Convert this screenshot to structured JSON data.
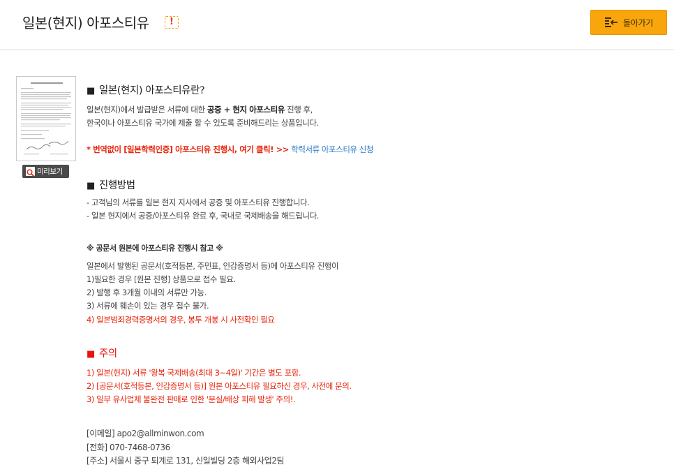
{
  "header": {
    "title": "일본(현지) 아포스티유",
    "alert_glyph": "!",
    "back_label": "돌아가기"
  },
  "sidebar": {
    "preview_label": "미리보기"
  },
  "intro": {
    "heading": "일본(현지) 아포스티유란?",
    "line1_a": "일본(현지)에서 발급받은 서류에 대한 ",
    "line1_b": "공증 + 현지 아포스티유",
    "line1_c": " 진행 후,",
    "line2": "한국이나 아포스티유 국가에 제출 할 수 있도록 준비해드리는 상품입니다.",
    "notice_text": "* 번역없이 [일본학력인증] 아포스티유 진행시, 여기 클릭! >>",
    "notice_link": " 학력서류 아포스티유 신청"
  },
  "process": {
    "heading": "진행방법",
    "lines": [
      "- 고객님의 서류를 일본 현지 지사에서 공증 및 아포스티유 진행합니다.",
      "- 일본 현지에서 공증/아포스티유 완료 후, 국내로 국제배송을 해드립니다."
    ],
    "note_title": "※ 공문서 원본에 아포스티유 진행시 참고 ※",
    "note_lines": [
      "일본에서 발행된 공문서(호적등본, 주민표, 인감증명서 등)에 아포스티유 진행이",
      "1)필요한 경우 [원본 진행] 상품으로 접수 필요.",
      "2) 발행 후 3개월 이내의 서류만 가능.",
      "3) 서류에 훼손이 있는 경우 접수 불가."
    ],
    "note_red": "4) 일본범죄경력증명서의 경우, 봉투 개봉 시 사전확인 필요"
  },
  "caution": {
    "heading": "주의",
    "lines": [
      "1) 일본(현지) 서류 '왕복 국제배송(최대 3~4일)' 기간은 별도 포함.",
      "2) [공문서(호적등본, 인감증명서 등)] 원본 아포스티유 필요하신 경우, 사전에 문의.",
      "3) 일부 유사업체 불완전 판매로 인한 '분실/배상 피해 발생' 주의!."
    ]
  },
  "contact": {
    "email": "[이메일] apo2@allminwon.com",
    "phone": "[전화] 070-7468-0736",
    "address": "[주소] 서울시 중구 퇴계로 131, 신일빌딩 2층 해외사업2팀"
  },
  "colors": {
    "accent": "#f9a60c",
    "red": "#e8240c",
    "link": "#2a78c8"
  }
}
